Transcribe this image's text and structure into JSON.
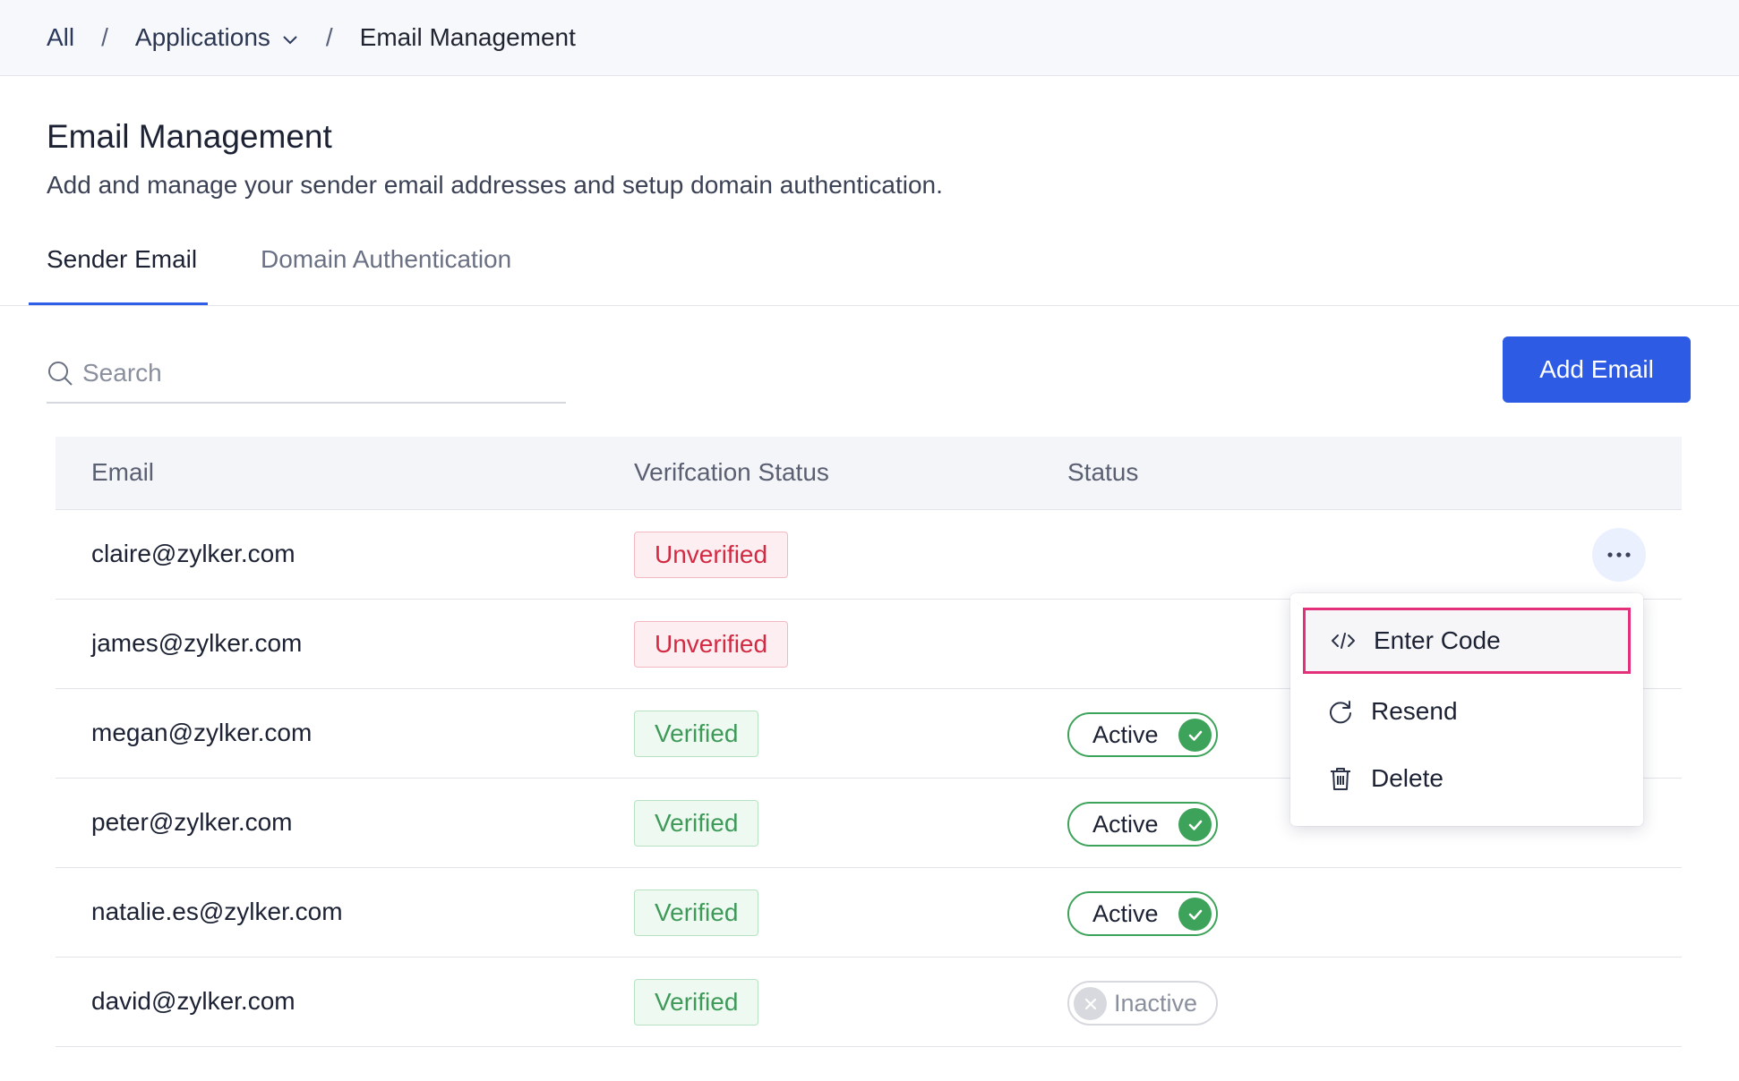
{
  "breadcrumb": {
    "all": "All",
    "separator": "/",
    "applications": "Applications",
    "current": "Email Management"
  },
  "header": {
    "title": "Email Management",
    "subtitle": "Add and manage your sender email addresses and setup domain authentication."
  },
  "tabs": {
    "sender_email": "Sender Email",
    "domain_authentication": "Domain Authentication",
    "active": "Sender Email"
  },
  "search": {
    "placeholder": "Search",
    "value": ""
  },
  "actions": {
    "add_email": "Add Email"
  },
  "table": {
    "columns": {
      "email": "Email",
      "verification_status": "Verifcation Status",
      "status": "Status"
    },
    "rows": [
      {
        "email": "claire@zylker.com",
        "verification": "Unverified",
        "status": ""
      },
      {
        "email": "james@zylker.com",
        "verification": "Unverified",
        "status": ""
      },
      {
        "email": "megan@zylker.com",
        "verification": "Verified",
        "status": "Active"
      },
      {
        "email": "peter@zylker.com",
        "verification": "Verified",
        "status": "Active"
      },
      {
        "email": "natalie.es@zylker.com",
        "verification": "Verified",
        "status": "Active"
      },
      {
        "email": "david@zylker.com",
        "verification": "Verified",
        "status": "Inactive"
      }
    ]
  },
  "row_menu": {
    "enter_code": "Enter Code",
    "resend": "Resend",
    "delete": "Delete",
    "highlighted": "Enter Code"
  },
  "icons": {
    "search": "search-icon",
    "chevron": "chevron-down-icon",
    "more": "more-horizontal-icon",
    "code": "code-icon",
    "resend": "refresh-icon",
    "delete": "trash-icon",
    "check": "check-icon",
    "close": "close-icon"
  },
  "colors": {
    "primary": "#2d5be3",
    "success": "#3ea35a",
    "danger": "#d32a44",
    "highlight_border": "#e2307a"
  }
}
